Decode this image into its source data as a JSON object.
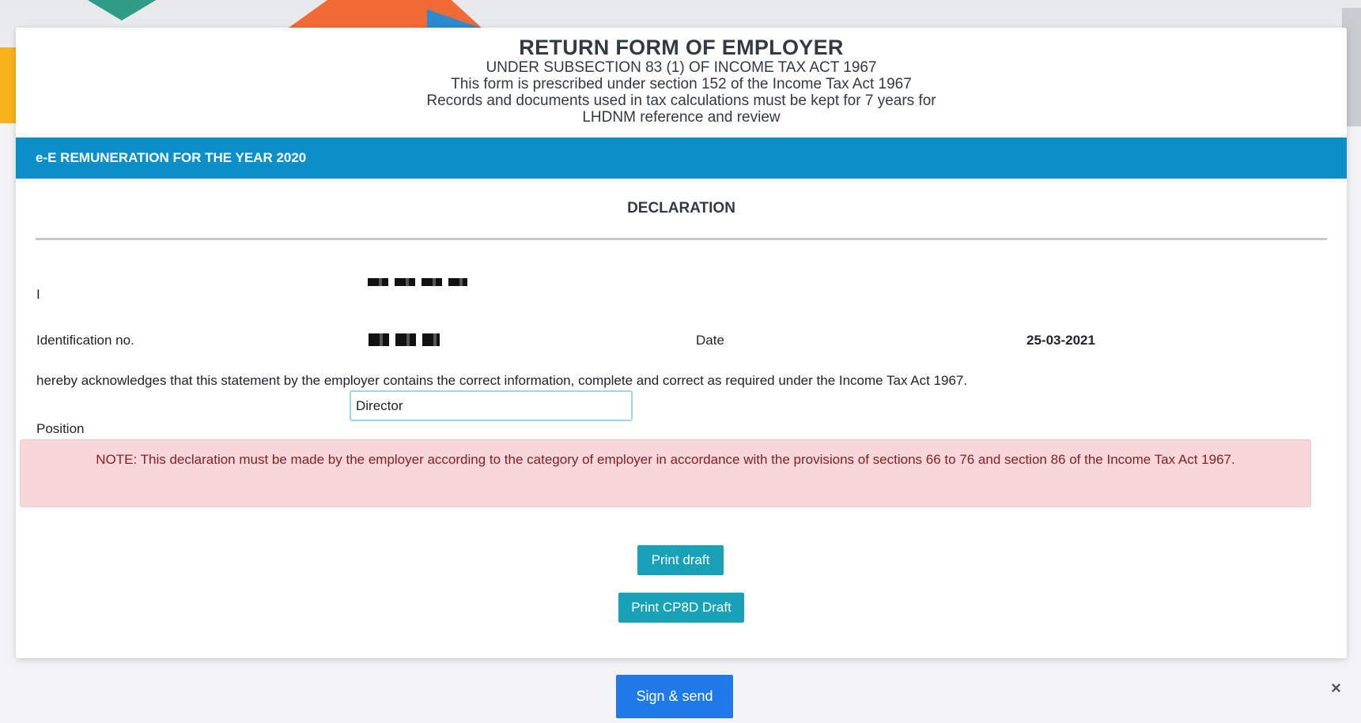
{
  "header": {
    "title": "RETURN FORM OF EMPLOYER",
    "line1": "UNDER SUBSECTION 83 (1) OF INCOME TAX ACT 1967",
    "line2": "This form is prescribed under section 152 of the Income Tax Act 1967",
    "line3": "Records and documents used in tax calculations must be kept for 7 years for",
    "line4": "LHDNM reference and review"
  },
  "band": {
    "label": "e-E REMUNERATION FOR THE YEAR 2020"
  },
  "declaration": {
    "title": "DECLARATION",
    "i_label": "I",
    "id_label": "Identification no.",
    "date_label": "Date",
    "date_value": "25-03-2021",
    "statement": "hereby acknowledges that this statement by the employer contains the correct information, complete and correct as required under the Income Tax Act 1967.",
    "position_label": "Position",
    "position_value": "Director",
    "note": "NOTE: This declaration must be made by the employer according to the category of employer in accordance with the provisions of sections 66 to 76 and section 86 of the Income Tax Act 1967."
  },
  "buttons": {
    "print_draft": "Print draft",
    "print_cp8d": "Print CP8D Draft",
    "sign_send": "Sign & send",
    "close": "×"
  },
  "colors": {
    "band": "#0a8fc8",
    "teal_button": "#17a2b8",
    "blue_button": "#1f7ae8",
    "note_bg": "#f8d7da",
    "note_text": "#842029"
  }
}
